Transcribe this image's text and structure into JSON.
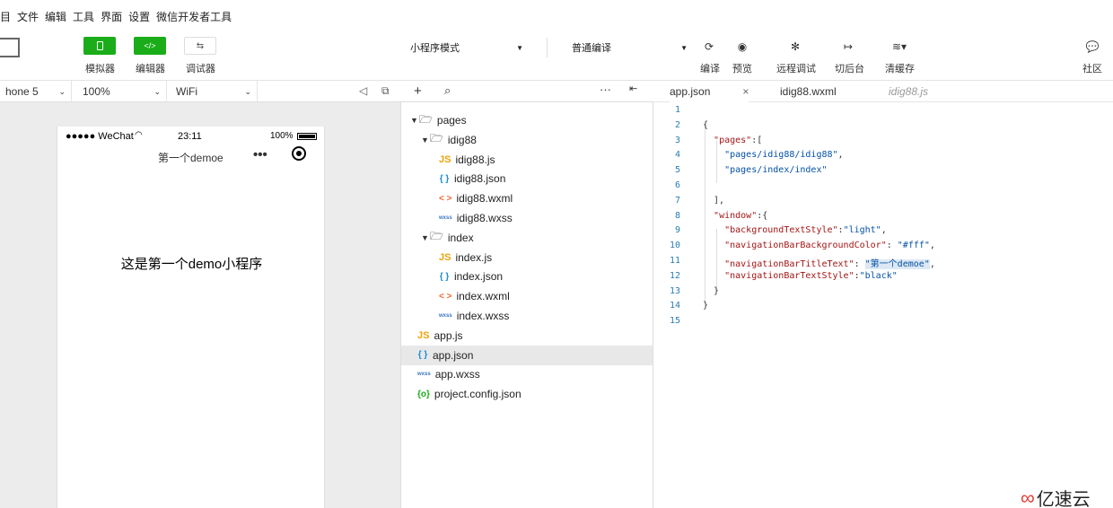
{
  "menu": [
    "目",
    "文件",
    "编辑",
    "工具",
    "界面",
    "设置",
    "微信开发者工具"
  ],
  "toolbar": {
    "simulator_label": "模拟器",
    "editor_label": "编辑器",
    "debugger_label": "调试器",
    "mode_select": "小程序模式",
    "compile_select": "普通编译",
    "compile_label": "编译",
    "preview_label": "预览",
    "remote_debug_label": "远程调试",
    "background_label": "切后台",
    "clear_cache_label": "清缓存",
    "community_label": "社区"
  },
  "simbar": {
    "device": "hone 5",
    "zoom": "100%",
    "network": "WiFi"
  },
  "phone": {
    "carrier": "●●●●● WeChat",
    "time": "23:11",
    "battery": "100%",
    "nav_title": "第一个demoe",
    "content_text": "这是第一个demo小程序"
  },
  "tree": [
    {
      "label": "pages",
      "type": "folder",
      "indent": 0,
      "open": true
    },
    {
      "label": "idig88",
      "type": "folder",
      "indent": 1,
      "open": true
    },
    {
      "label": "idig88.js",
      "type": "js",
      "indent": 2
    },
    {
      "label": "idig88.json",
      "type": "json",
      "indent": 2
    },
    {
      "label": "idig88.wxml",
      "type": "wxml",
      "indent": 2
    },
    {
      "label": "idig88.wxss",
      "type": "wxss",
      "indent": 2
    },
    {
      "label": "index",
      "type": "folder",
      "indent": 1,
      "open": true
    },
    {
      "label": "index.js",
      "type": "js",
      "indent": 2
    },
    {
      "label": "index.json",
      "type": "json",
      "indent": 2
    },
    {
      "label": "index.wxml",
      "type": "wxml",
      "indent": 2
    },
    {
      "label": "index.wxss",
      "type": "wxss",
      "indent": 2
    },
    {
      "label": "app.js",
      "type": "js",
      "indent": 0
    },
    {
      "label": "app.json",
      "type": "json",
      "indent": 0,
      "selected": true
    },
    {
      "label": "app.wxss",
      "type": "wxss",
      "indent": 0
    },
    {
      "label": "project.config.json",
      "type": "proj",
      "indent": 0
    }
  ],
  "icons": {
    "js": "JS",
    "json": "{ }",
    "wxml": "< >",
    "wxss": "wxss",
    "proj": "{o}"
  },
  "tabs": [
    {
      "label": "app.json",
      "close": "×",
      "active": true
    },
    {
      "label": "idig88.wxml"
    },
    {
      "label": "idig88.js",
      "italic": true
    }
  ],
  "code_lines": [
    "",
    "{",
    "  \"pages\":[",
    "    \"pages/idig88/idig88\",",
    "    \"pages/index/index\"",
    "",
    "  ],",
    "  \"window\":{",
    "    \"backgroundTextStyle\":\"light\",",
    "    \"navigationBarBackgroundColor\": \"#fff\",",
    "    \"navigationBarTitleText\": \"第一个demoe\",",
    "    \"navigationBarTextStyle\":\"black\"",
    "  }",
    "}",
    ""
  ],
  "watermark": "亿速云",
  "colors": {
    "accent": "#1aad19",
    "line_number": "#2a7db3",
    "json_key": "#a31515",
    "json_string": "#0451a5"
  }
}
